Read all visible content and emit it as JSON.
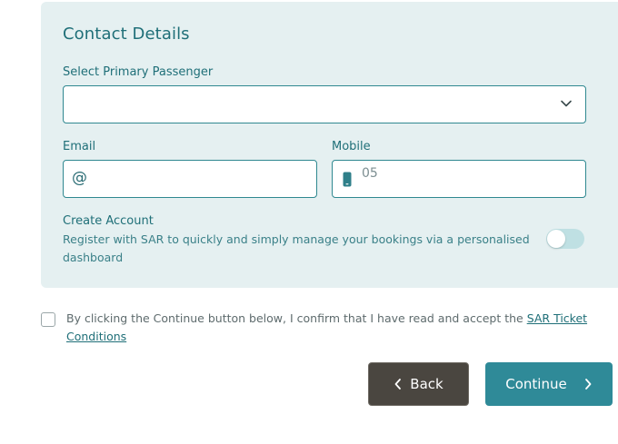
{
  "contact": {
    "title": "Contact Details",
    "primary_passenger_label": "Select Primary Passenger",
    "primary_passenger_value": "",
    "email_label": "Email",
    "email_icon": "@",
    "email_value": "",
    "mobile_label": "Mobile",
    "mobile_placeholder": "05",
    "create_account_label": "Create Account",
    "create_account_desc": "Register with SAR to quickly and simply manage your bookings via a personalised dashboard",
    "create_account_enabled": false
  },
  "terms": {
    "text": "By clicking the Continue button below, I confirm that I have read and accept the ",
    "link_text": "SAR Ticket Conditions",
    "checked": false
  },
  "buttons": {
    "back_label": "Back",
    "continue_label": "Continue"
  },
  "colors": {
    "panel_bg": "#e5f0f1",
    "accent": "#1f6f78",
    "continue_bg": "#2f8a98",
    "back_bg": "#4a4640"
  },
  "icons": {
    "select": "chevron-down-icon",
    "email": "at-sign-icon",
    "mobile": "phone-icon",
    "back": "chevron-left-icon",
    "continue": "chevron-right-icon"
  }
}
